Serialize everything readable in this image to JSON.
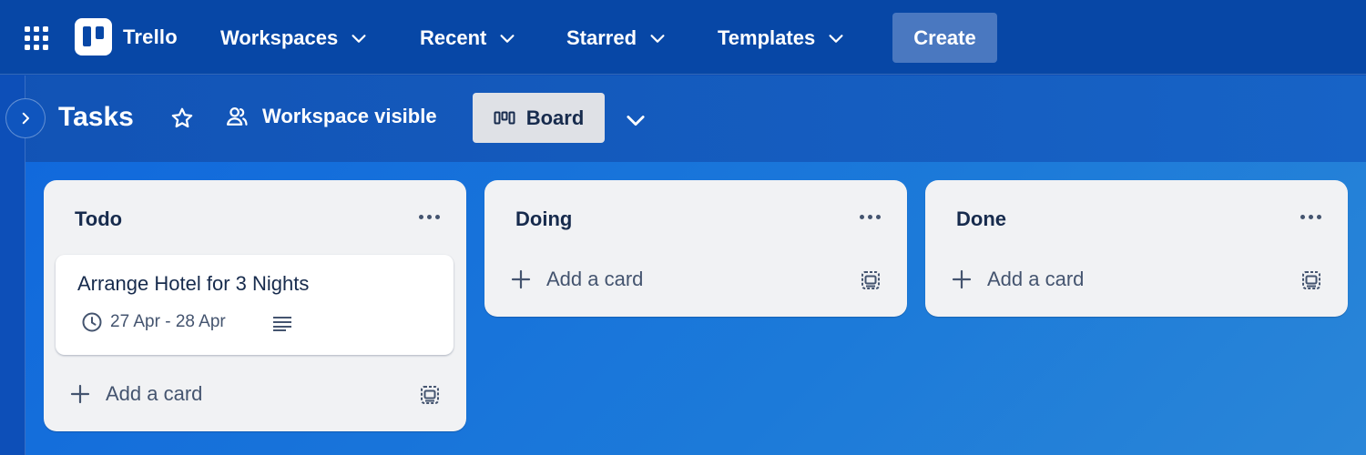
{
  "nav": {
    "app_switcher_icon": "grid-icon",
    "logo_text": "Trello",
    "menus": [
      {
        "label": "Workspaces"
      },
      {
        "label": "Recent"
      },
      {
        "label": "Starred"
      },
      {
        "label": "Templates"
      }
    ],
    "create_label": "Create"
  },
  "board": {
    "title": "Tasks",
    "visibility_label": "Workspace visible",
    "view_label": "Board"
  },
  "lists": [
    {
      "title": "Todo",
      "cards": [
        {
          "title": "Arrange Hotel for 3 Nights",
          "dates": "27 Apr - 28 Apr",
          "has_description": true
        }
      ],
      "add_card_label": "Add a card"
    },
    {
      "title": "Doing",
      "cards": [],
      "add_card_label": "Add a card"
    },
    {
      "title": "Done",
      "cards": [],
      "add_card_label": "Add a card"
    }
  ],
  "colors": {
    "nav_bg": "#0747a6",
    "create_bg": "#4a78c0",
    "list_bg": "#f1f2f4",
    "text_dark": "#172b4d"
  }
}
